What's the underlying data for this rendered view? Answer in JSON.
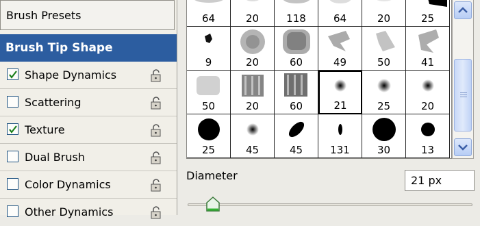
{
  "left_panel": {
    "brush_presets": "Brush Presets",
    "brush_tip_shape": "Brush Tip Shape",
    "options": [
      {
        "label": "Shape Dynamics",
        "checked": true
      },
      {
        "label": "Scattering",
        "checked": false
      },
      {
        "label": "Texture",
        "checked": true
      },
      {
        "label": "Dual Brush",
        "checked": false
      },
      {
        "label": "Color Dynamics",
        "checked": false
      },
      {
        "label": "Other Dynamics",
        "checked": false
      }
    ],
    "lock_icon": "lock-icon"
  },
  "brush_grid": {
    "rows": [
      [
        "64",
        "20",
        "118",
        "64",
        "20",
        "25"
      ],
      [
        "9",
        "20",
        "60",
        "49",
        "50",
        "41"
      ],
      [
        "50",
        "20",
        "60",
        "21",
        "25",
        "20"
      ],
      [
        "25",
        "45",
        "45",
        "131",
        "30",
        "13"
      ]
    ],
    "selected": "21"
  },
  "diameter": {
    "label": "Diameter",
    "value": "21 px"
  },
  "colors": {
    "selected_panel": "#2c5da0",
    "scroll_accent": "#b7cdf5"
  }
}
